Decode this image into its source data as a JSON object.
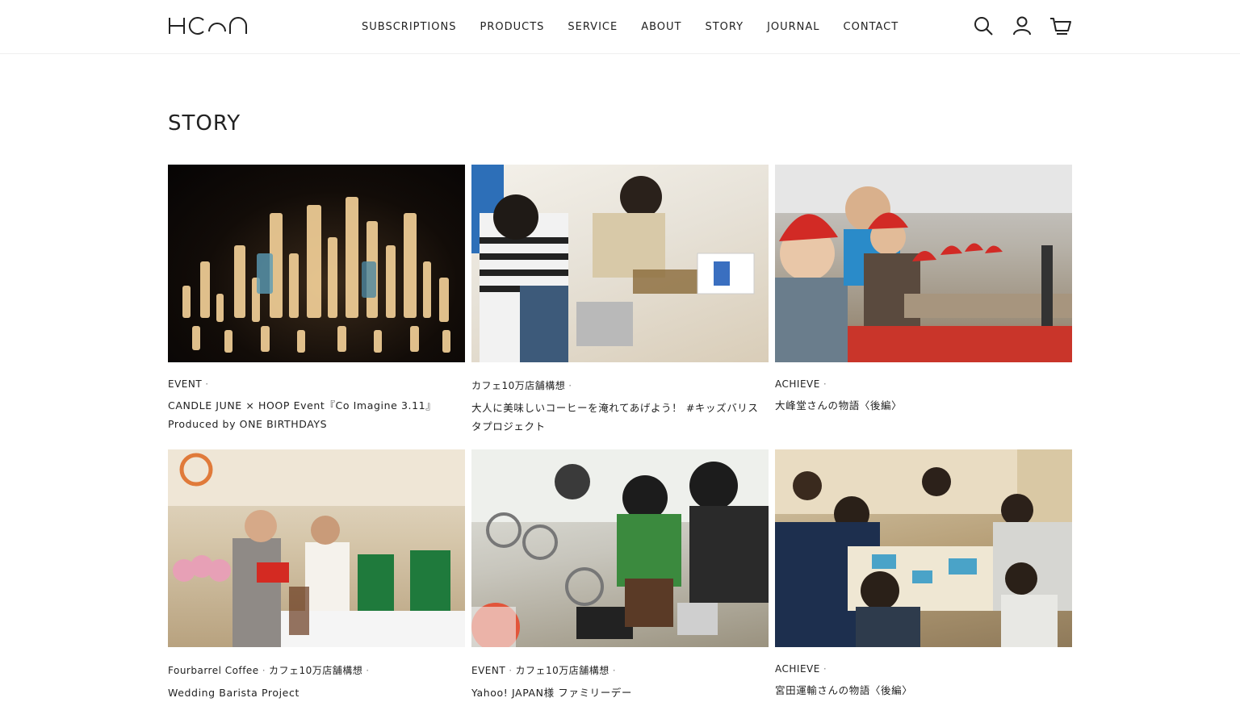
{
  "brand": {
    "logo_text": "HOOP"
  },
  "nav": {
    "items": [
      {
        "label": "SUBSCRIPTIONS"
      },
      {
        "label": "PRODUCTS"
      },
      {
        "label": "SERVICE"
      },
      {
        "label": "ABOUT"
      },
      {
        "label": "STORY"
      },
      {
        "label": "JOURNAL"
      },
      {
        "label": "CONTACT"
      }
    ]
  },
  "header_icons": [
    "search-icon",
    "account-icon",
    "cart-icon"
  ],
  "page": {
    "title": "STORY"
  },
  "cards": [
    {
      "categories": [
        "EVENT"
      ],
      "title": "CANDLE JUNE × HOOP Event『Co Imagine 3.11』Produced by ONE BIRTHDAYS",
      "image": "candles-photo"
    },
    {
      "categories": [
        "カフェ10万店舗構想"
      ],
      "title": "大人に美味しいコーヒーを淹れてあげよう！ #キッズバリスタプロジェクト",
      "image": "kids-barista-photo"
    },
    {
      "categories": [
        "ACHIEVE"
      ],
      "title": "大峰堂さんの物語〈後編〉",
      "image": "santa-hats-photo"
    },
    {
      "categories": [
        "Fourbarrel Coffee",
        "カフェ10万店舗構想"
      ],
      "title": "Wedding Barista Project",
      "image": "wedding-photo"
    },
    {
      "categories": [
        "EVENT",
        "カフェ10万店舗構想"
      ],
      "title": "Yahoo! JAPAN様 ファミリーデー",
      "image": "family-day-photo"
    },
    {
      "categories": [
        "ACHIEVE"
      ],
      "title": "宮田運輸さんの物語〈後編〉",
      "image": "family-table-photo"
    }
  ],
  "category_separator": "·"
}
